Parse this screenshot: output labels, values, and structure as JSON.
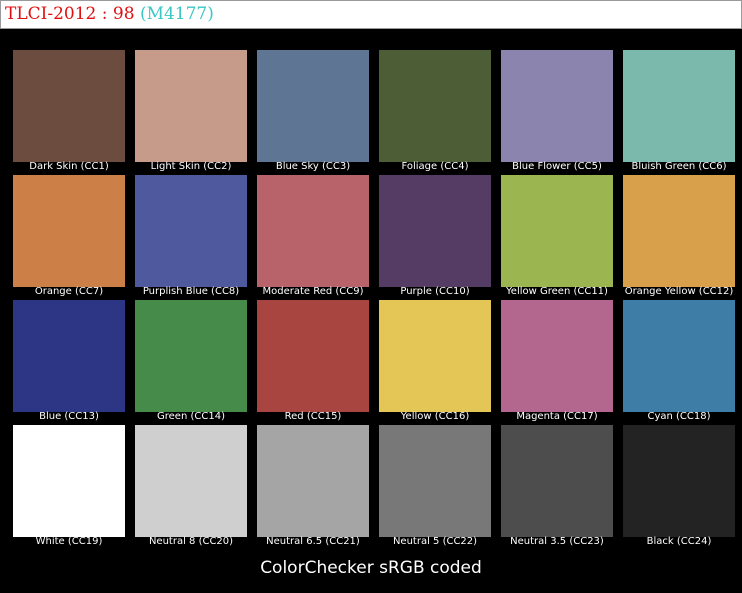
{
  "header": {
    "title": "TLCI-2012 : 98",
    "code": "(M4177)"
  },
  "patches": [
    {
      "label": "Dark Skin (CC1)",
      "color": "#6b4c3e"
    },
    {
      "label": "Light Skin (CC2)",
      "color": "#c69b8a"
    },
    {
      "label": "Blue Sky (CC3)",
      "color": "#5f7594"
    },
    {
      "label": "Foliage (CC4)",
      "color": "#4d5d35"
    },
    {
      "label": "Blue Flower (CC5)",
      "color": "#8a84ae"
    },
    {
      "label": "Bluish Green (CC6)",
      "color": "#7bb9ad"
    },
    {
      "label": "Orange (CC7)",
      "color": "#cc7f46"
    },
    {
      "label": "Purplish Blue (CC8)",
      "color": "#4e5a9d"
    },
    {
      "label": "Moderate Red (CC9)",
      "color": "#b8636a"
    },
    {
      "label": "Purple (CC10)",
      "color": "#553c65"
    },
    {
      "label": "Yellow Green (CC11)",
      "color": "#9bb550"
    },
    {
      "label": "Orange Yellow (CC12)",
      "color": "#d9a04c"
    },
    {
      "label": "Blue (CC13)",
      "color": "#2d3685"
    },
    {
      "label": "Green (CC14)",
      "color": "#478b4a"
    },
    {
      "label": "Red (CC15)",
      "color": "#a84541"
    },
    {
      "label": "Yellow (CC16)",
      "color": "#e3c655"
    },
    {
      "label": "Magenta (CC17)",
      "color": "#b3678e"
    },
    {
      "label": "Cyan (CC18)",
      "color": "#3e7ea6"
    },
    {
      "label": "White (CC19)",
      "color": "#ffffff"
    },
    {
      "label": "Neutral 8 (CC20)",
      "color": "#cfcfcf"
    },
    {
      "label": "Neutral 6.5 (CC21)",
      "color": "#a5a5a5"
    },
    {
      "label": "Neutral 5 (CC22)",
      "color": "#787878"
    },
    {
      "label": "Neutral 3.5 (CC23)",
      "color": "#4d4d4d"
    },
    {
      "label": "Black (CC24)",
      "color": "#232323"
    }
  ],
  "caption": "ColorChecker sRGB coded"
}
